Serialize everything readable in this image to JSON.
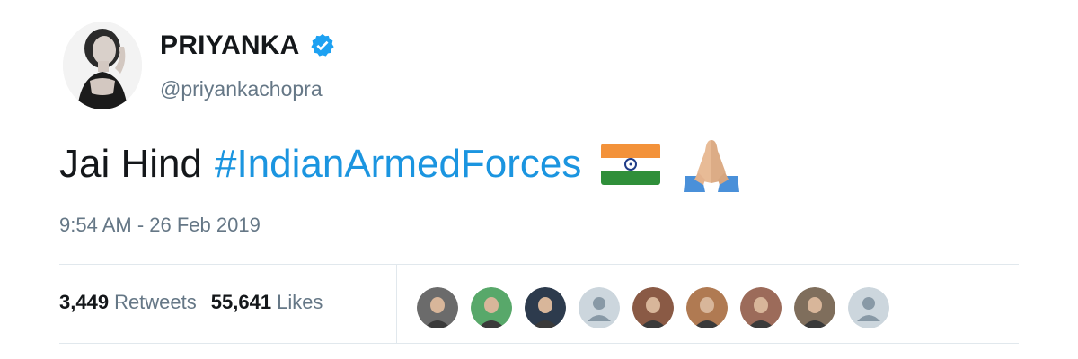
{
  "user": {
    "display_name": "PRIYANKA",
    "handle": "@priyankachopra",
    "verified": true
  },
  "tweet": {
    "text": "Jai Hind",
    "hashtag": "#IndianArmedForces",
    "emojis": [
      "india-flag-icon",
      "folded-hands-icon"
    ],
    "timestamp": "9:54 AM - 26 Feb 2019"
  },
  "stats": {
    "retweets_count": "3,449",
    "retweets_label": "Retweets",
    "likes_count": "55,641",
    "likes_label": "Likes"
  },
  "likers": [
    {
      "name": "liker-avatar-1",
      "tone": "#6b6b6b"
    },
    {
      "name": "liker-avatar-2",
      "tone": "#58a86a"
    },
    {
      "name": "liker-avatar-3",
      "tone": "#2d3b4d"
    },
    {
      "name": "liker-avatar-4",
      "tone": "#cfd9de",
      "default": true
    },
    {
      "name": "liker-avatar-5",
      "tone": "#8a5a45"
    },
    {
      "name": "liker-avatar-6",
      "tone": "#b07a52"
    },
    {
      "name": "liker-avatar-7",
      "tone": "#9c6b5a"
    },
    {
      "name": "liker-avatar-8",
      "tone": "#7f6e5c"
    },
    {
      "name": "liker-avatar-9",
      "tone": "#cfd9de",
      "default": true
    }
  ],
  "colors": {
    "hashtag": "#1b95e0",
    "verified_badge": "#1da1f2",
    "muted_text": "#657786",
    "divider": "#e1e8ed"
  }
}
